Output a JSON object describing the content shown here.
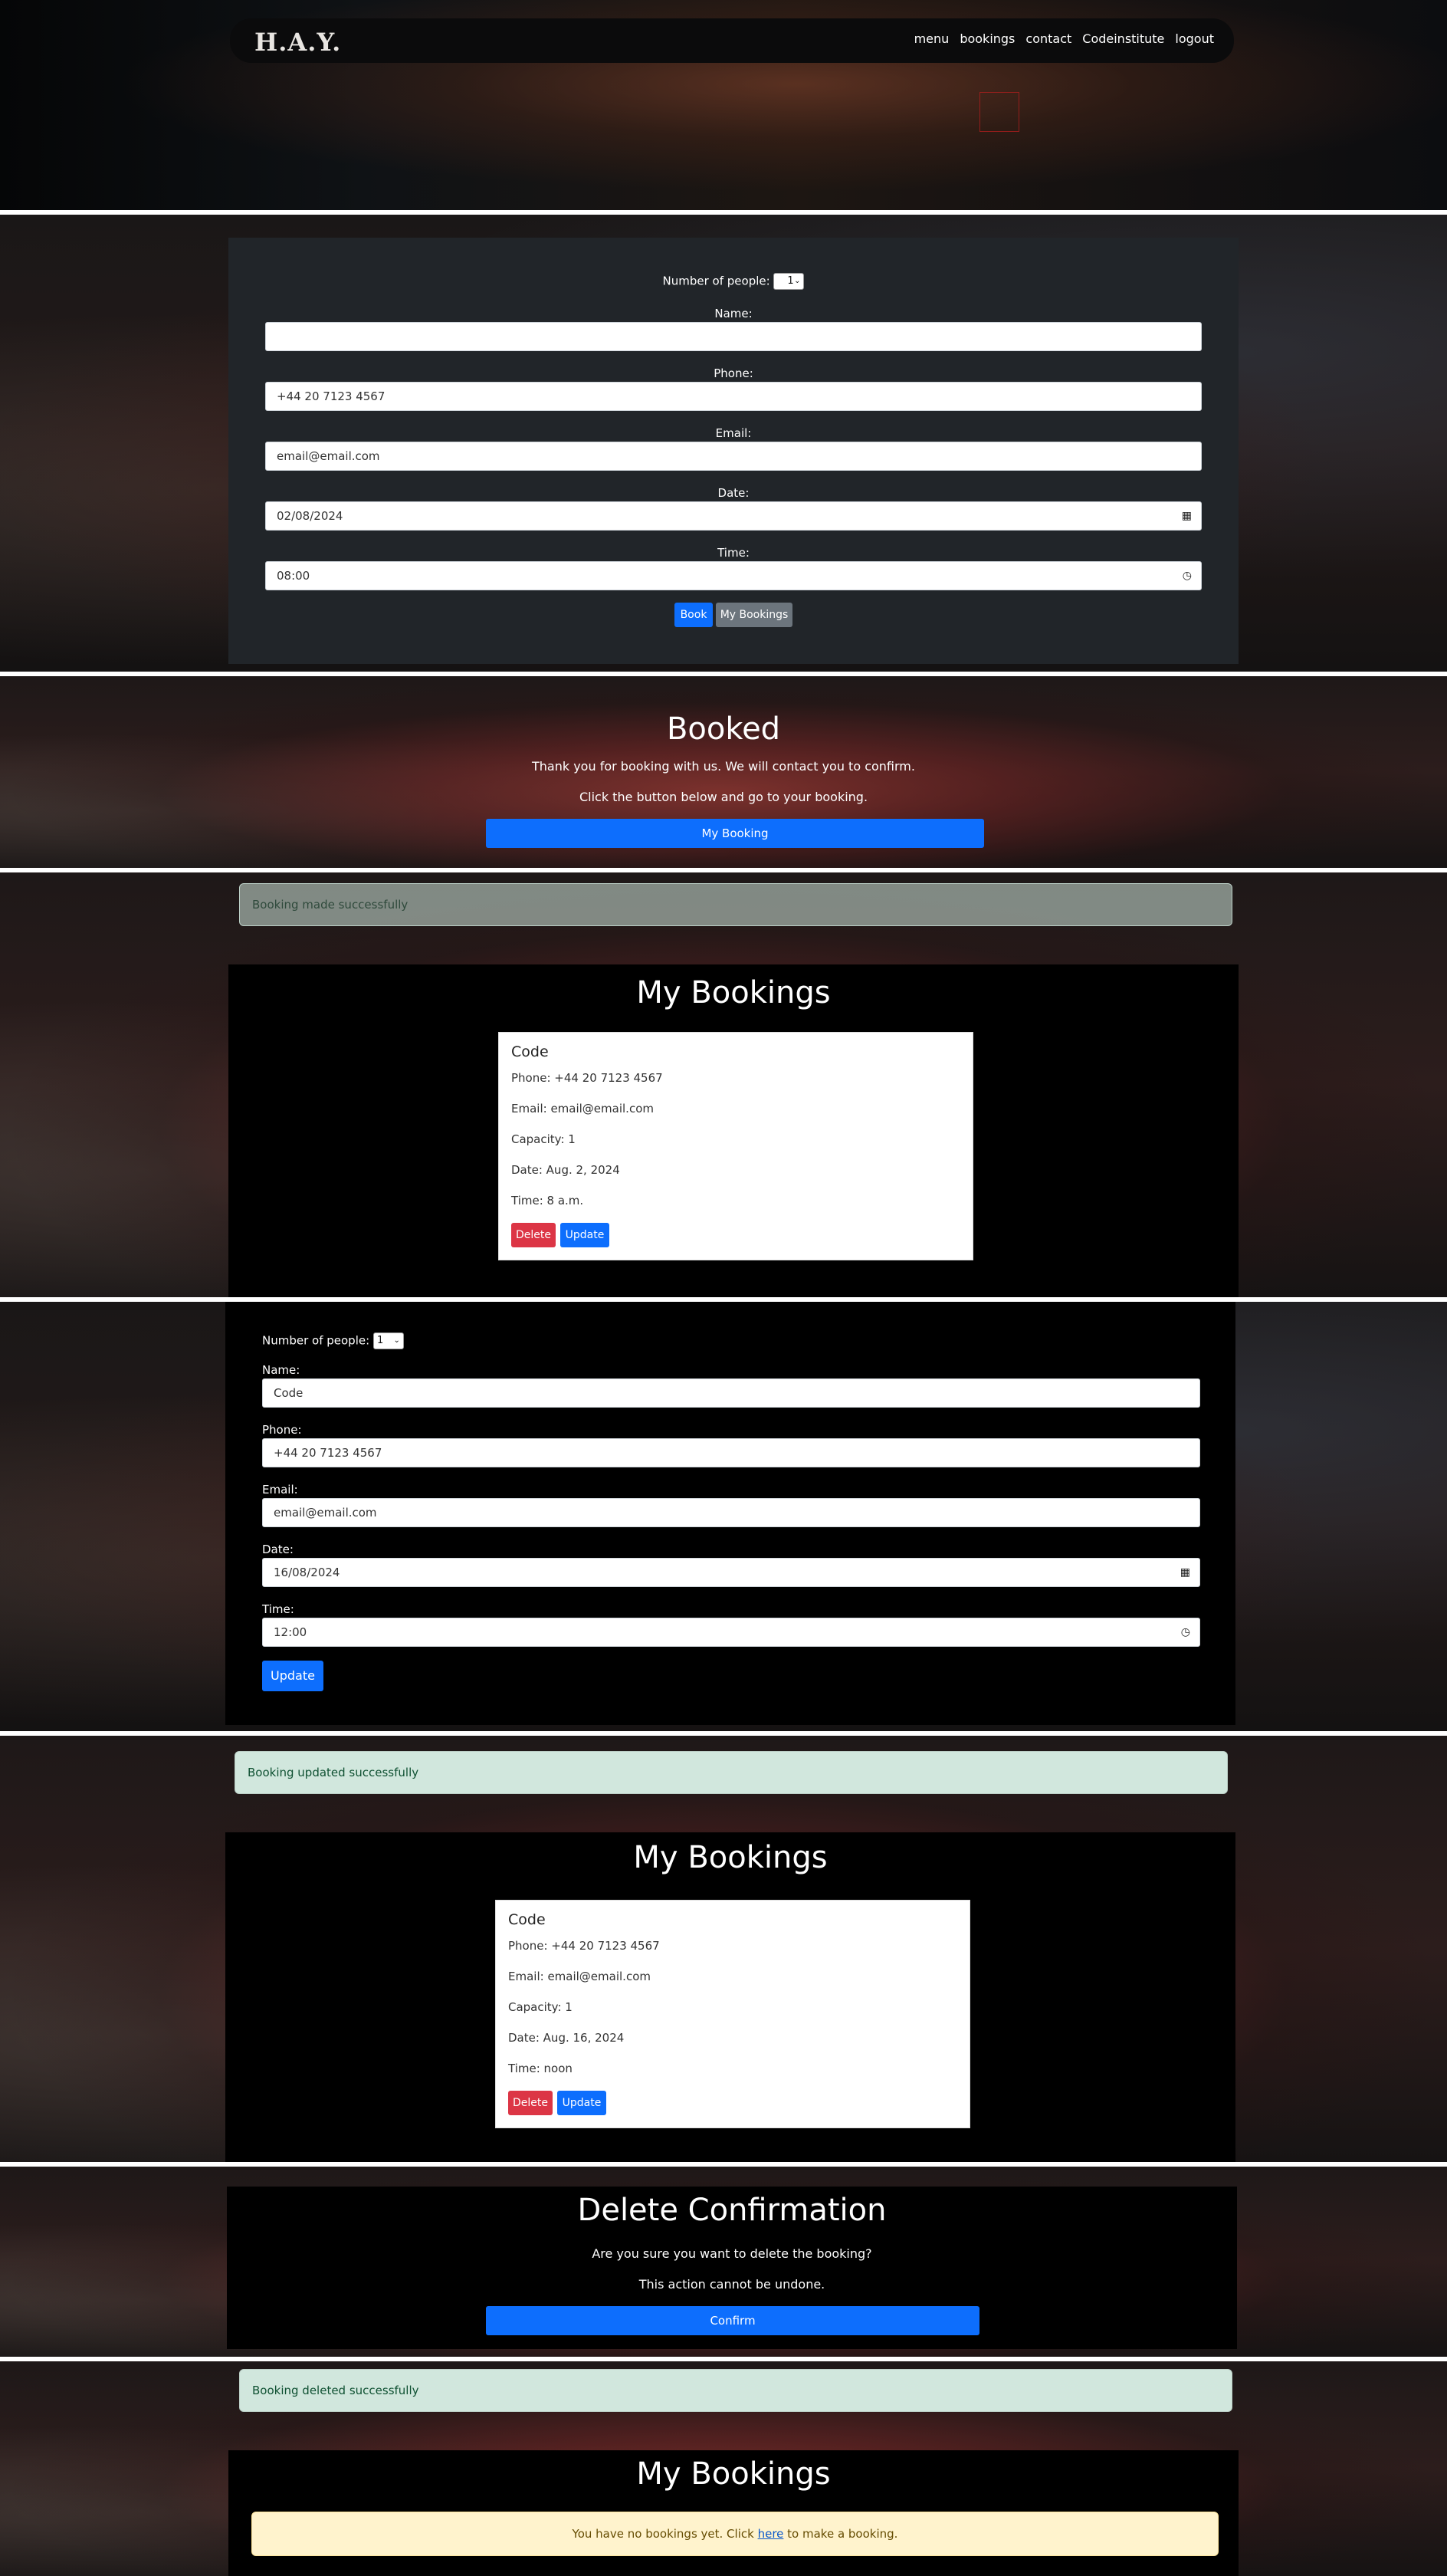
{
  "navbar": {
    "logo": "H.A.Y.",
    "links": [
      "menu",
      "bookings",
      "contact",
      "Codeinstitute",
      "logout"
    ]
  },
  "booking_form": {
    "people_label": "Number of people:",
    "people_value": "1",
    "name_label": "Name:",
    "name_value": "",
    "phone_label": "Phone:",
    "phone_value": "+44 20 7123 4567",
    "email_label": "Email:",
    "email_value": "email@email.com",
    "date_label": "Date:",
    "date_value": "02/08/2024",
    "time_label": "Time:",
    "time_value": "08:00",
    "book_button": "Book",
    "my_bookings_button": "My Bookings"
  },
  "booked": {
    "title": "Booked",
    "line1": "Thank you for booking with us. We will contact you to confirm.",
    "line2": "Click the button below and go to your booking.",
    "button": "My Booking"
  },
  "bookings_1": {
    "alert": "Booking made successfully",
    "title": "My Bookings",
    "card_name": "Code",
    "phone": "Phone: +44 20 7123 4567",
    "email": "Email: email@email.com",
    "capacity": "Capacity: 1",
    "date": "Date: Aug. 2, 2024",
    "time": "Time: 8 a.m.",
    "delete": "Delete",
    "update": "Update"
  },
  "update_form": {
    "people_label": "Number of people:",
    "people_value": "1",
    "name_label": "Name:",
    "name_value": "Code",
    "phone_label": "Phone:",
    "phone_value": "+44 20 7123 4567",
    "email_label": "Email:",
    "email_value": "email@email.com",
    "date_label": "Date:",
    "date_value": "16/08/2024",
    "time_label": "Time:",
    "time_value": "12:00",
    "update_button": "Update"
  },
  "bookings_2": {
    "alert": "Booking updated successfully",
    "title": "My Bookings",
    "card_name": "Code",
    "phone": "Phone: +44 20 7123 4567",
    "email": "Email: email@email.com",
    "capacity": "Capacity: 1",
    "date": "Date: Aug. 16, 2024",
    "time": "Time: noon",
    "delete": "Delete",
    "update": "Update"
  },
  "delete_confirm": {
    "title": "Delete Confirmation",
    "line1": "Are you sure you want to delete the booking?",
    "line2": "This action cannot be undone.",
    "button": "Confirm"
  },
  "bookings_3": {
    "alert": "Booking deleted successfully",
    "title": "My Bookings",
    "empty_prefix": "You have no bookings yet. Click ",
    "empty_link": "here",
    "empty_suffix": " to make a booking."
  },
  "icons": {
    "calendar": "calendar-icon",
    "clock": "clock-icon",
    "chevron": "chevron-down-icon"
  }
}
